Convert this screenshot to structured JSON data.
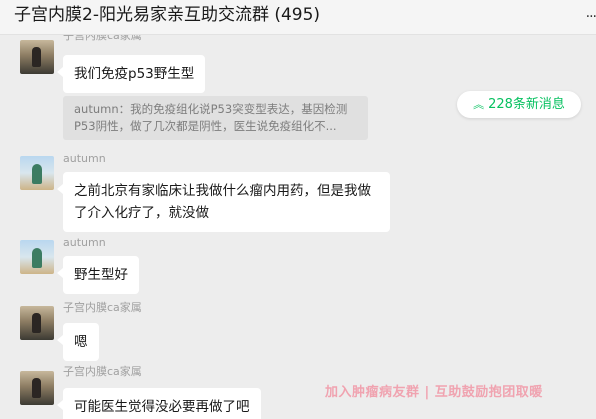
{
  "window": {
    "title": "子宫内膜2-阳光易家亲互助交流群 (495)",
    "more_icon": "more-dots-icon"
  },
  "new_messages": {
    "count_label": "228条新消息",
    "icon": "chevron-up-icon",
    "color": "#07c160"
  },
  "messages": [
    {
      "sender": "子宫内膜ca家属",
      "avatar": "desert-avatar",
      "text": "我们免疫p53野生型",
      "quote": "autumn：我的免疫组化说P53突变型表达，基因检测P53阴性，做了几次都是阴性，医生说免疫组化不..."
    },
    {
      "sender": "autumn",
      "avatar": "sky-avatar",
      "text": "之前北京有家临床让我做什么瘤内用药，但是我做了介入化疗了，就没做"
    },
    {
      "sender": "autumn",
      "avatar": "sky-avatar",
      "text": "野生型好"
    },
    {
      "sender": "子宫内膜ca家属",
      "avatar": "desert-avatar",
      "text": "嗯"
    },
    {
      "sender": "子宫内膜ca家属",
      "avatar": "desert-avatar",
      "text": "可能医生觉得没必要再做了吧"
    }
  ],
  "watermark": "加入肿瘤病友群 | 互助鼓励抱团取暖"
}
